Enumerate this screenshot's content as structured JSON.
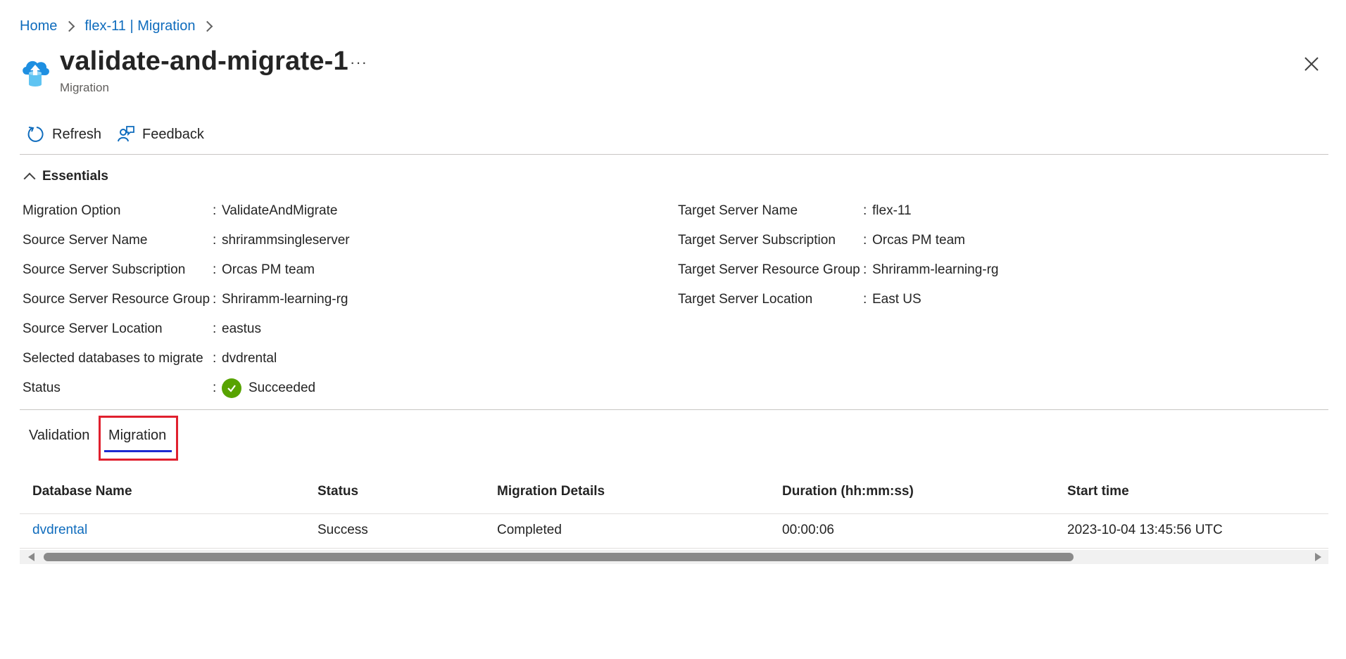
{
  "breadcrumb": {
    "home": "Home",
    "parent": "flex-11 | Migration"
  },
  "header": {
    "title": "validate-and-migrate-1",
    "subtitle": "Migration",
    "more": "···",
    "icon": "cloud-upload-database-icon"
  },
  "toolbar": {
    "refresh": "Refresh",
    "feedback": "Feedback"
  },
  "essentials": {
    "title": "Essentials",
    "left": [
      {
        "label": "Migration Option",
        "value": "ValidateAndMigrate"
      },
      {
        "label": "Source Server Name",
        "value": "shrirammsingleserver"
      },
      {
        "label": "Source Server Subscription",
        "value": "Orcas PM team"
      },
      {
        "label": "Source Server Resource Group",
        "value": "Shriramm-learning-rg"
      },
      {
        "label": "Source Server Location",
        "value": "eastus"
      },
      {
        "label": "Selected databases to migrate",
        "value": "dvdrental"
      },
      {
        "label": "Status",
        "value": "Succeeded"
      }
    ],
    "right": [
      {
        "label": "Target Server Name",
        "value": "flex-11"
      },
      {
        "label": "Target Server Subscription",
        "value": "Orcas PM team"
      },
      {
        "label": "Target Server Resource Group",
        "value": "Shriramm-learning-rg"
      },
      {
        "label": "Target Server Location",
        "value": "East US"
      }
    ],
    "separator": ":"
  },
  "tabs": {
    "validation": "Validation",
    "migration": "Migration",
    "selected": "Migration"
  },
  "table": {
    "headers": [
      "Database Name",
      "Status",
      "Migration Details",
      "Duration (hh:mm:ss)",
      "Start time"
    ],
    "rows": [
      [
        "dvdrental",
        "Success",
        "Completed",
        "00:00:06",
        "2023-10-04 13:45:56 UTC"
      ]
    ]
  },
  "colors": {
    "link": "#0f6cbd",
    "success": "#57a300",
    "highlight": "#e0202e",
    "tab_underline": "#1d2bd0"
  }
}
